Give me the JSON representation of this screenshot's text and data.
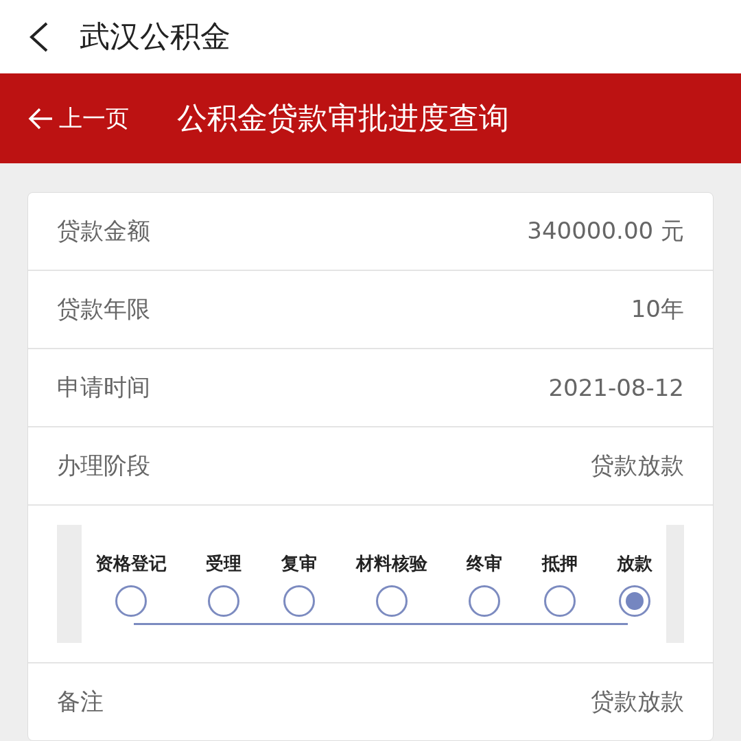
{
  "app_bar": {
    "title": "武汉公积金"
  },
  "header": {
    "back_label": "上一页",
    "title": "公积金贷款审批进度查询"
  },
  "details": [
    {
      "label": "贷款金额",
      "value": "340000.00 元"
    },
    {
      "label": "贷款年限",
      "value": "10年"
    },
    {
      "label": "申请时间",
      "value": "2021-08-12"
    },
    {
      "label": "办理阶段",
      "value": "贷款放款"
    }
  ],
  "steps": [
    {
      "label": "资格登记",
      "selected": false
    },
    {
      "label": "受理",
      "selected": false
    },
    {
      "label": "复审",
      "selected": false
    },
    {
      "label": "材料核验",
      "selected": false
    },
    {
      "label": "终审",
      "selected": false
    },
    {
      "label": "抵押",
      "selected": false
    },
    {
      "label": "放款",
      "selected": true
    }
  ],
  "remark": {
    "label": "备注",
    "value": "贷款放款"
  }
}
